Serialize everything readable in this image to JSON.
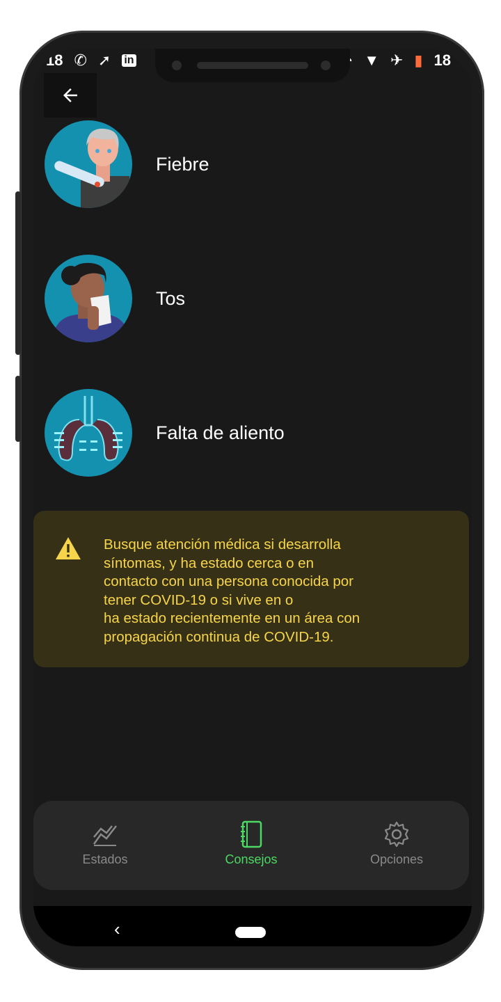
{
  "status_bar": {
    "left_items": [
      "18",
      "whatsapp-icon",
      "share-icon",
      "linkedin-icon"
    ],
    "right_items": [
      "sync-icon",
      "wifi-icon",
      "airplane-icon",
      "battery-icon"
    ],
    "time": "18"
  },
  "header": {
    "back_icon": "arrow-left-icon"
  },
  "symptoms": [
    {
      "label": "Fiebre",
      "icon": "fever-avatar"
    },
    {
      "label": "Tos",
      "icon": "cough-avatar"
    },
    {
      "label": "Falta de aliento",
      "icon": "lungs-avatar"
    }
  ],
  "warning": {
    "icon": "warning-icon",
    "lines": [
      "Busque atención médica si desarrolla",
      "síntomas, y ha estado cerca o en",
      "contacto con una persona conocida por",
      "tener COVID-19 o si vive en o",
      "ha estado recientemente en un área con",
      "propagación continua de COVID-19."
    ],
    "text_color": "#f7d54a",
    "background": "#353016"
  },
  "bottom_nav": {
    "items": [
      {
        "label": "Estados",
        "icon": "chart-trend-icon",
        "active": false
      },
      {
        "label": "Consejos",
        "icon": "notebook-icon",
        "active": true
      },
      {
        "label": "Opciones",
        "icon": "gear-icon",
        "active": false
      }
    ],
    "active_color": "#4cd964",
    "inactive_color": "#8a8a8a"
  }
}
